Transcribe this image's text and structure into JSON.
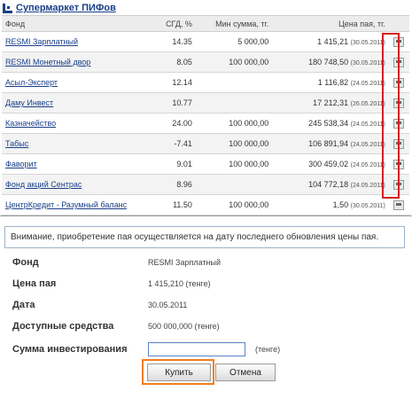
{
  "header": {
    "title": "Супермаркет ПИФов"
  },
  "table": {
    "columns": [
      "Фонд",
      "СГД, %",
      "Мин сумма, тг.",
      "Цена пая, тг."
    ],
    "rows": [
      {
        "fund": "RESMI Зарплатный",
        "cgd": "14.35",
        "min": "5 000,00",
        "price": "1 415,21",
        "date": "(30.05.2011)"
      },
      {
        "fund": "RESMI Монетный двор",
        "cgd": "8.05",
        "min": "100 000,00",
        "price": "180 748,50",
        "date": "(30.05.2011)"
      },
      {
        "fund": "Асыл-Эксперт",
        "cgd": "12.14",
        "min": "",
        "price": "1 116,82",
        "date": "(24.05.2011)"
      },
      {
        "fund": "Даму Инвест",
        "cgd": "10.77",
        "min": "",
        "price": "17 212,31",
        "date": "(26.05.2011)"
      },
      {
        "fund": "Казначейство",
        "cgd": "24.00",
        "min": "100 000,00",
        "price": "245 538,34",
        "date": "(24.05.2011)"
      },
      {
        "fund": "Табыс",
        "cgd": "-7.41",
        "min": "100 000,00",
        "price": "106 891,94",
        "date": "(24.05.2011)"
      },
      {
        "fund": "Фаворит",
        "cgd": "9.01",
        "min": "100 000,00",
        "price": "300 459,02",
        "date": "(24.05.2011)"
      },
      {
        "fund": "Фонд акций Сентрас",
        "cgd": "8.96",
        "min": "",
        "price": "104 772,18",
        "date": "(24.05.2011)"
      },
      {
        "fund": "ЦентрКредит - Разумный баланс",
        "cgd": "11.50",
        "min": "100 000,00",
        "price": "1,50",
        "date": "(30.05.2011)"
      }
    ]
  },
  "notice": "Внимание, приобретение пая осуществляется на дату последнего обновления цены пая.",
  "form": {
    "fund_label": "Фонд",
    "fund_value": "RESMI Зарплатный",
    "price_label": "Цена пая",
    "price_value": "1 415,210 (тенге)",
    "date_label": "Дата",
    "date_value": "30.05.2011",
    "funds_label": "Доступные средства",
    "funds_value": "500 000,000 (тенге)",
    "amount_label": "Сумма инвестирования",
    "amount_value": "",
    "amount_unit": "(тенге)"
  },
  "buttons": {
    "buy": "Купить",
    "cancel": "Отмена"
  },
  "colors": {
    "link": "#1a3f8a",
    "cart_highlight": "#d42020",
    "buy_highlight": "#f07e1f"
  },
  "icons": {
    "title": "grid-icon",
    "cart": "cart-icon"
  }
}
